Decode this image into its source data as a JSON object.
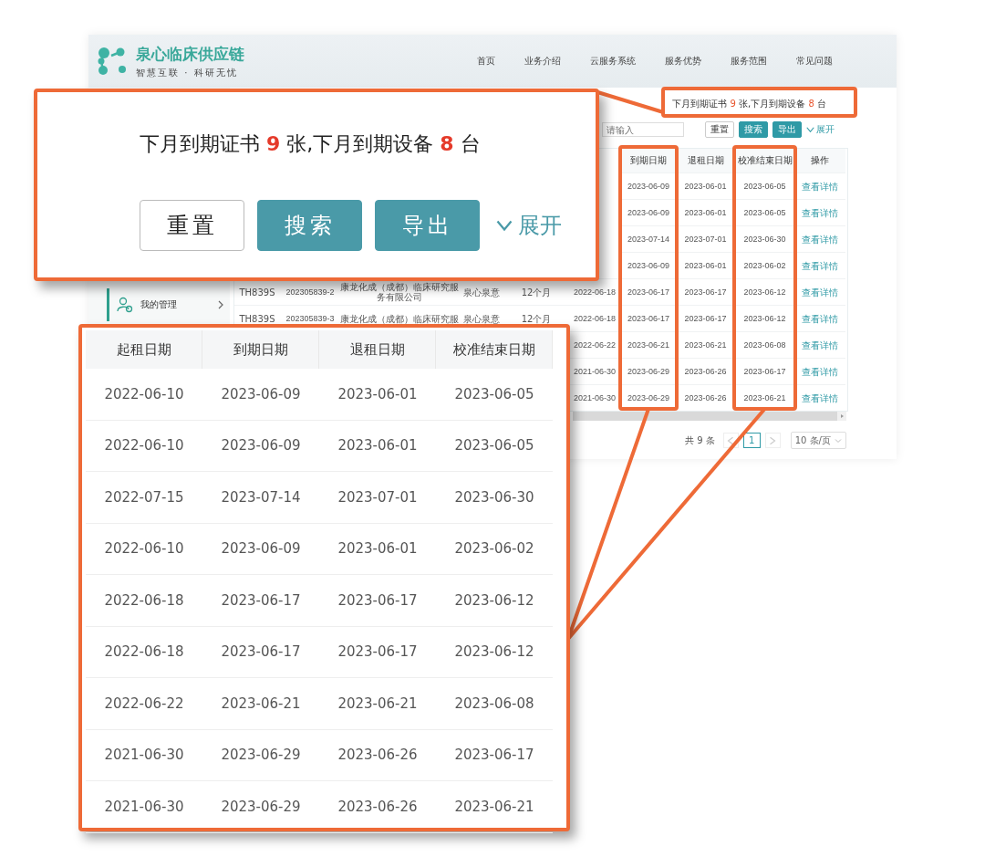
{
  "header": {
    "logo_title": "泉心临床供应链",
    "logo_subtitle": "智慧互联 · 科研无忧",
    "nav": [
      "首页",
      "业务介绍",
      "云服务系统",
      "服务优势",
      "服务范围",
      "常见问题"
    ]
  },
  "sidebar": {
    "items": [
      {
        "label": "我的管理",
        "selected": true
      }
    ]
  },
  "notice": {
    "segments": [
      {
        "text": "下月到期证书 ",
        "highlight": false
      },
      {
        "text": "9",
        "highlight": true
      },
      {
        "text": " 张,下月到期设备 ",
        "highlight": false
      },
      {
        "text": "8",
        "highlight": true
      },
      {
        "text": " 台",
        "highlight": false
      }
    ]
  },
  "search": {
    "placeholder": "请输入"
  },
  "buttons": [
    {
      "label": "重置",
      "kind": "default"
    },
    {
      "label": "搜索",
      "kind": "primary"
    },
    {
      "label": "导出",
      "kind": "primary"
    }
  ],
  "expand": {
    "label": "展开",
    "expanded": false
  },
  "table": {
    "columns": [
      null,
      null,
      null,
      null,
      null,
      null,
      {
        "label": "到期日期",
        "highlighted": true
      },
      {
        "label": "退租日期",
        "highlighted": false
      },
      {
        "label": "校准结束日期",
        "highlighted": true
      },
      {
        "label": "操作",
        "highlighted": false
      }
    ],
    "rows": [
      {
        "cells": [
          null,
          null,
          null,
          null,
          null,
          null,
          "2023-06-09",
          "2023-06-01",
          "2023-06-05",
          "查看详情"
        ]
      },
      {
        "cells": [
          null,
          null,
          null,
          null,
          null,
          null,
          "2023-06-09",
          "2023-06-01",
          "2023-06-05",
          "查看详情"
        ]
      },
      {
        "cells": [
          null,
          null,
          null,
          null,
          null,
          null,
          "2023-07-14",
          "2023-07-01",
          "2023-06-30",
          "查看详情"
        ]
      },
      {
        "cells": [
          null,
          null,
          null,
          null,
          null,
          null,
          "2023-06-09",
          "2023-06-01",
          "2023-06-02",
          "查看详情"
        ]
      },
      {
        "cells": [
          "TH839S",
          "202305839-2",
          "康龙化成（成都）临床研究服务有限公司",
          "泉心泉意",
          "12个月",
          "2022-06-18",
          "2023-06-17",
          "2023-06-17",
          "2023-06-12",
          "查看详情"
        ]
      },
      {
        "cells": [
          "TH839S",
          "202305839-3",
          "康龙化成（成都）临床研究服",
          "泉心泉意",
          "12个月",
          "2022-06-18",
          "2023-06-17",
          "2023-06-17",
          "2023-06-12",
          "查看详情"
        ]
      },
      {
        "cells": [
          null,
          null,
          null,
          null,
          null,
          "2022-06-22",
          "2023-06-21",
          "2023-06-21",
          "2023-06-08",
          "查看详情"
        ]
      },
      {
        "cells": [
          null,
          null,
          null,
          null,
          null,
          "2021-06-30",
          "2023-06-29",
          "2023-06-26",
          "2023-06-17",
          "查看详情"
        ]
      },
      {
        "cells": [
          null,
          null,
          null,
          null,
          null,
          "2021-06-30",
          "2023-06-29",
          "2023-06-26",
          "2023-06-21",
          "查看详情"
        ]
      }
    ]
  },
  "pagination": {
    "total": "共 9 条",
    "pages": [
      {
        "label": "1",
        "selected": true
      }
    ],
    "page_size": "10 条/页"
  },
  "callout_notice": {
    "segments": [
      {
        "text": "下月到期证书 ",
        "highlight": false
      },
      {
        "text": "9",
        "highlight": true
      },
      {
        "text": " 张,下月到期设备 ",
        "highlight": false
      },
      {
        "text": "8",
        "highlight": true
      },
      {
        "text": " 台",
        "highlight": false
      }
    ],
    "buttons": [
      {
        "label": "重置",
        "kind": "default"
      },
      {
        "label": "搜索",
        "kind": "primary"
      },
      {
        "label": "导出",
        "kind": "primary"
      }
    ],
    "expand": {
      "label": "展开",
      "expanded": false
    }
  },
  "callout_table": {
    "columns": [
      "起租日期",
      "到期日期",
      "退租日期",
      "校准结束日期"
    ],
    "rows": [
      [
        "2022-06-10",
        "2023-06-09",
        "2023-06-01",
        "2023-06-05"
      ],
      [
        "2022-06-10",
        "2023-06-09",
        "2023-06-01",
        "2023-06-05"
      ],
      [
        "2022-07-15",
        "2023-07-14",
        "2023-07-01",
        "2023-06-30"
      ],
      [
        "2022-06-10",
        "2023-06-09",
        "2023-06-01",
        "2023-06-02"
      ],
      [
        "2022-06-18",
        "2023-06-17",
        "2023-06-17",
        "2023-06-12"
      ],
      [
        "2022-06-18",
        "2023-06-17",
        "2023-06-17",
        "2023-06-12"
      ],
      [
        "2022-06-22",
        "2023-06-21",
        "2023-06-21",
        "2023-06-08"
      ],
      [
        "2021-06-30",
        "2023-06-29",
        "2023-06-26",
        "2023-06-17"
      ],
      [
        "2021-06-30",
        "2023-06-29",
        "2023-06-26",
        "2023-06-21"
      ]
    ]
  }
}
